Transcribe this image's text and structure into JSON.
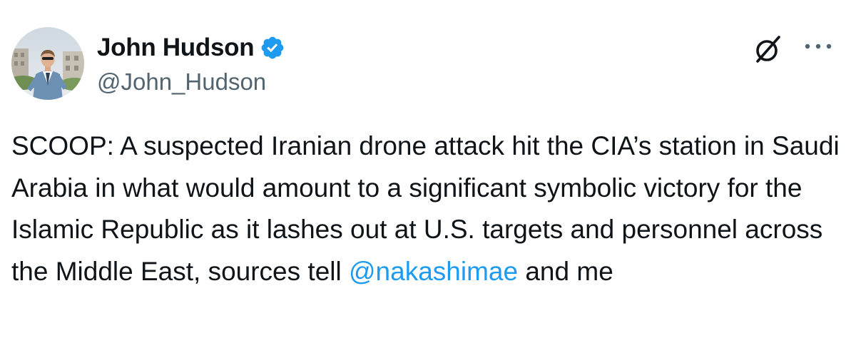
{
  "author": {
    "display_name": "John Hudson",
    "handle": "@John_Hudson",
    "verified": true
  },
  "tweet": {
    "text_before": "SCOOP: A suspected Iranian drone attack hit the CIA’s station in Saudi Arabia in what would amount to a significant symbolic victory for the Islamic Republic as it lashes out at U.S. targets and personnel across the Middle East, sources tell ",
    "mention": "@nakashimae",
    "text_after": " and me"
  },
  "icons": {
    "avatar": "profile-photo",
    "verified": "verified-badge-icon",
    "grok": "grok-icon",
    "more": "more-options-icon"
  },
  "colors": {
    "text": "#0f1419",
    "secondary_text": "#536471",
    "link": "#1d9bf0",
    "verified": "#1d9bf0"
  }
}
